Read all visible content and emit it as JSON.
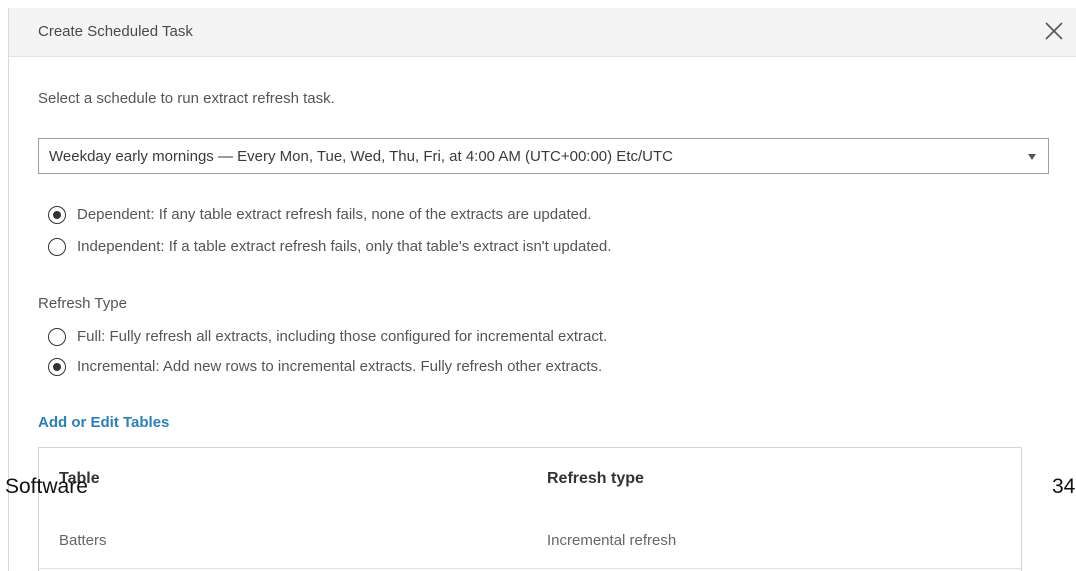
{
  "dialog": {
    "title": "Create Scheduled Task",
    "close_icon": "close-icon",
    "instruction": "Select a schedule to run extract refresh task.",
    "schedule_select": {
      "value": "Weekday early mornings — Every Mon, Tue, Wed, Thu, Fri, at 4:00 AM (UTC+00:00) Etc/UTC",
      "icon": "chevron-down-icon"
    },
    "dependency_options": [
      {
        "label": "Dependent: If any table extract refresh fails, none of the extracts are updated.",
        "checked": true
      },
      {
        "label": "Independent: If a table extract refresh fails, only that table's extract isn't updated.",
        "checked": false
      }
    ],
    "refresh_type_label": "Refresh Type",
    "refresh_type_options": [
      {
        "label": "Full: Fully refresh all extracts, including those configured for incremental extract.",
        "checked": false
      },
      {
        "label": "Incremental: Add new rows to incremental extracts. Fully refresh other extracts.",
        "checked": true
      }
    ],
    "add_edit_tables_link": "Add or Edit Tables",
    "table": {
      "headers": [
        "Table",
        "Refresh type"
      ],
      "rows": [
        [
          "Batters",
          "Incremental refresh"
        ]
      ]
    }
  },
  "overlay": {
    "left_text": "Software",
    "right_text": "34"
  },
  "colors": {
    "header_bg": "#f4f4f4",
    "link": "#2d7fb6",
    "text": "#555555"
  }
}
